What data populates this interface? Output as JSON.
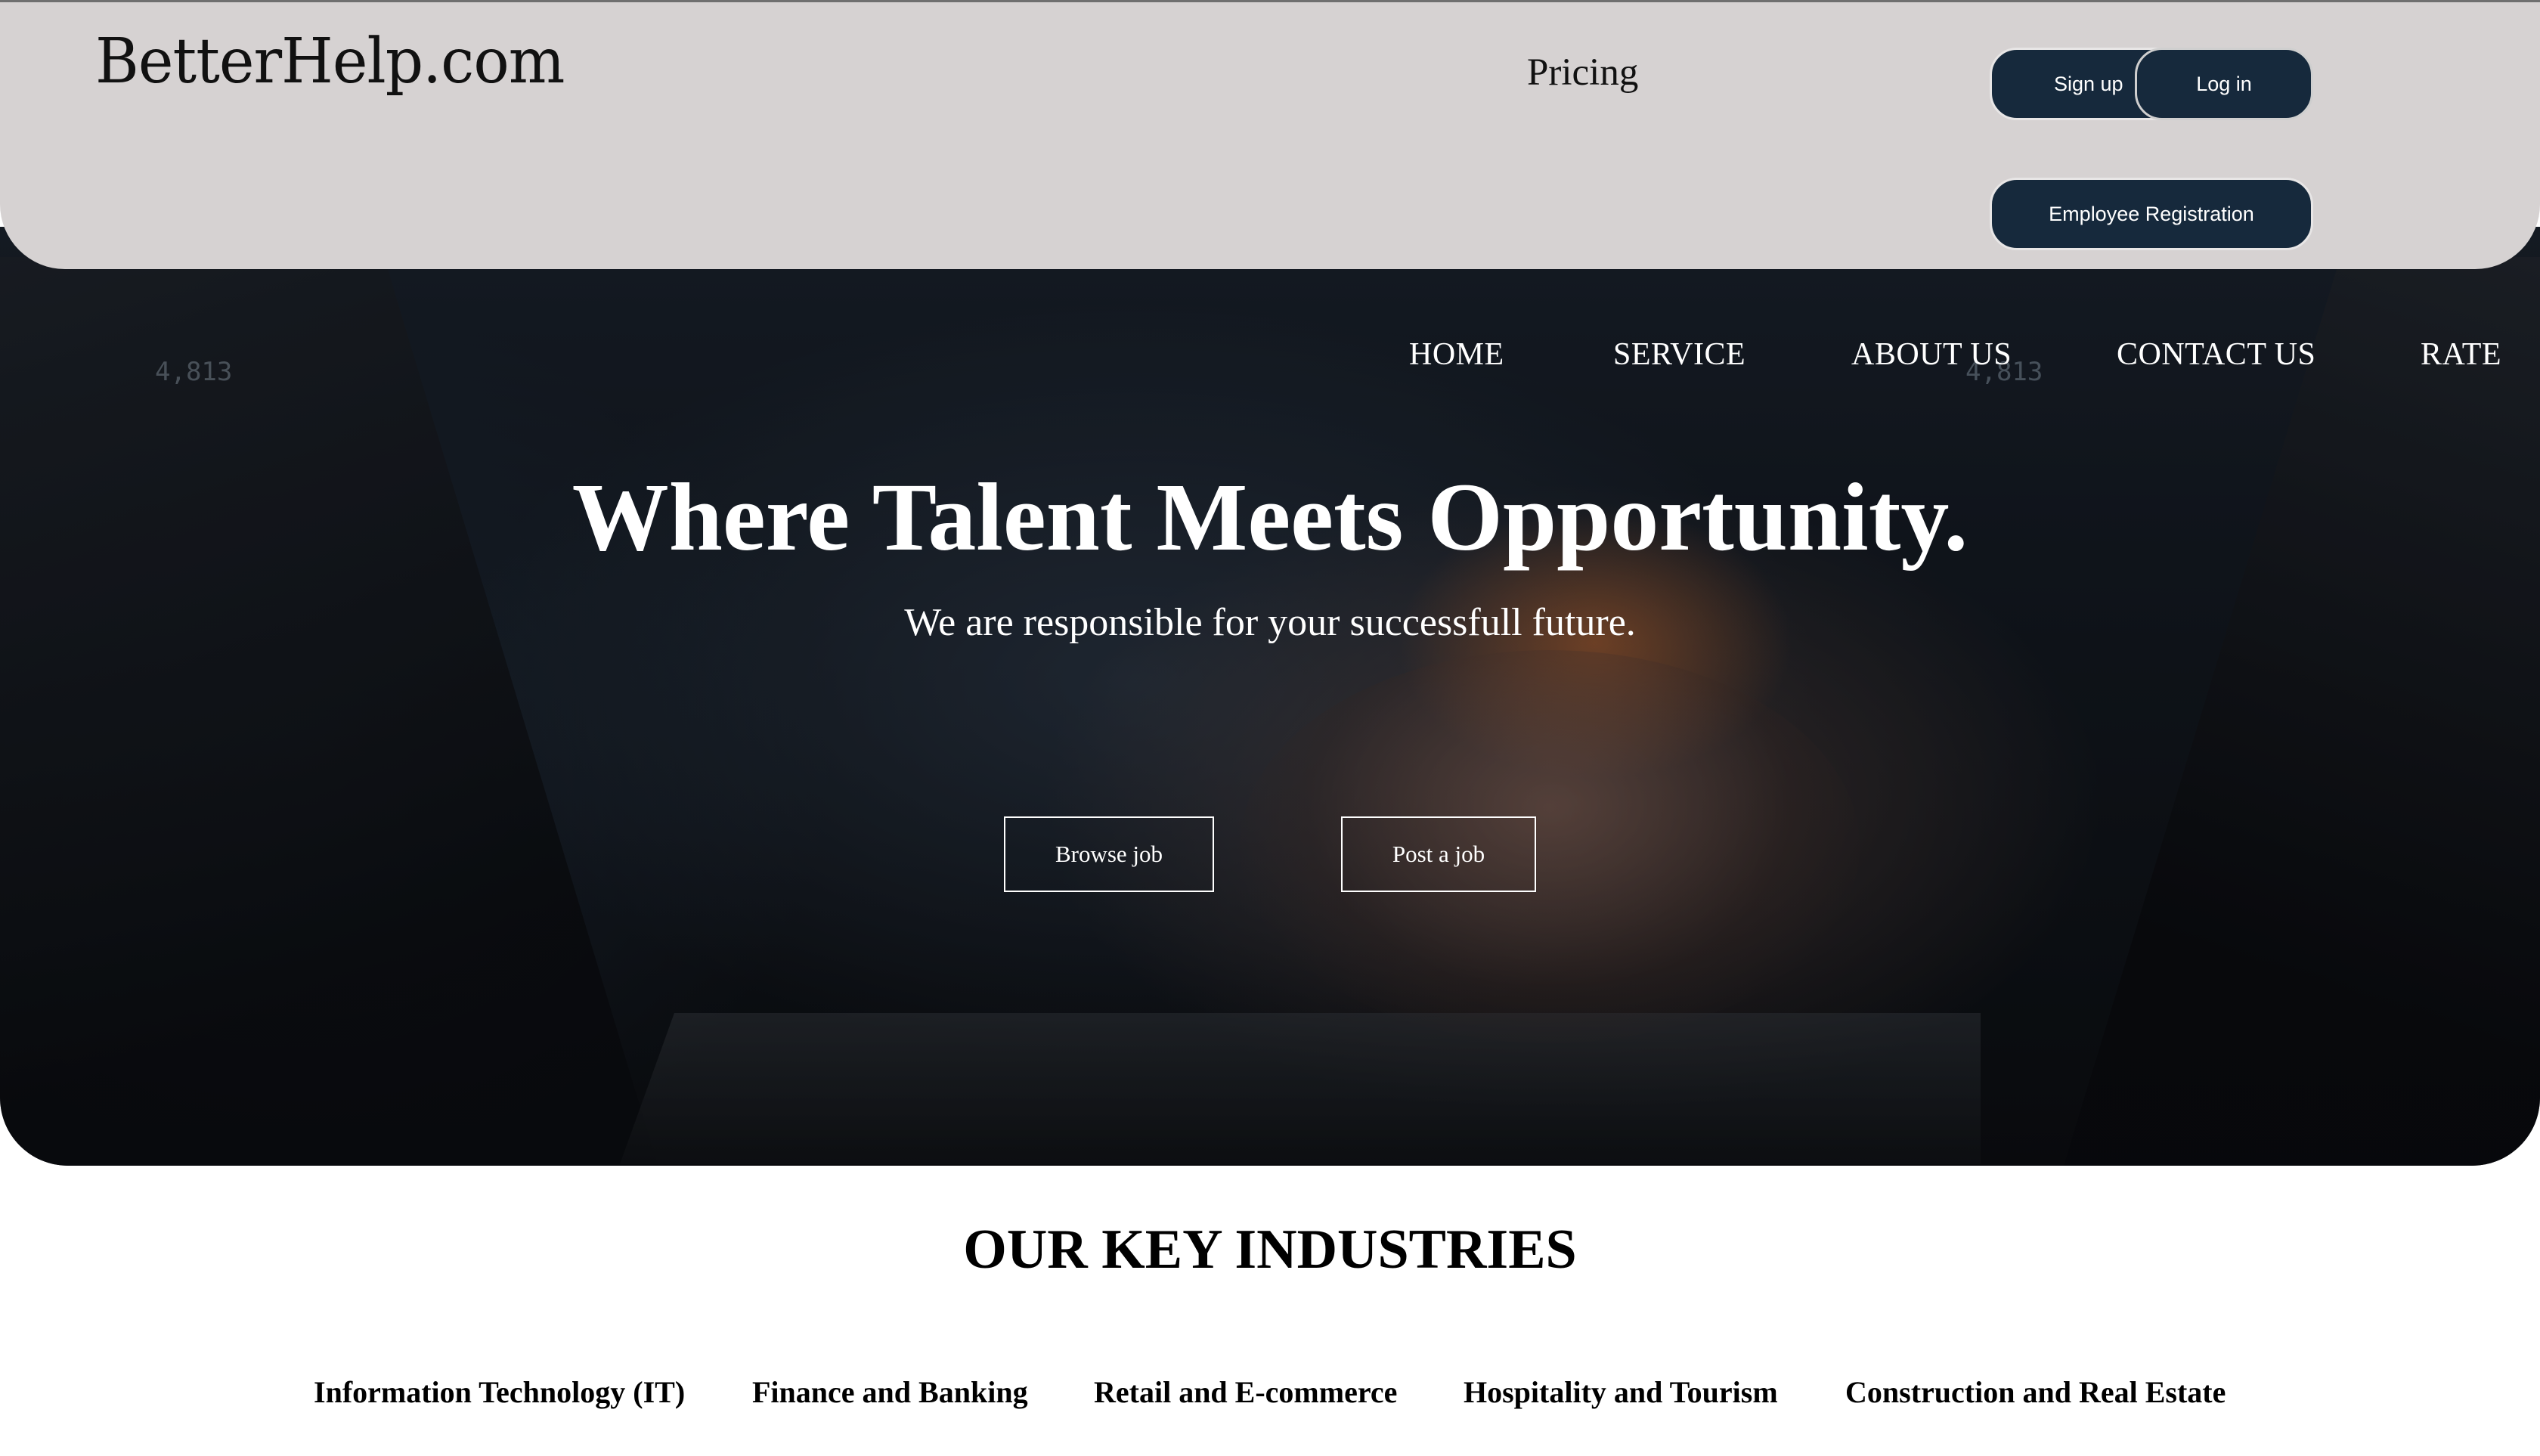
{
  "header": {
    "logo_text": "BetterHelp.com",
    "pricing_label": "Pricing",
    "signup_label": "Sign up",
    "login_label": "Log in",
    "employee_registration_label": "Employee Registration"
  },
  "nav": {
    "items": [
      {
        "label": "HOME"
      },
      {
        "label": "SERVICE"
      },
      {
        "label": "ABOUT US"
      },
      {
        "label": "CONTACT US"
      },
      {
        "label": "RATE"
      }
    ]
  },
  "hero": {
    "headline": "Where Talent Meets Opportunity.",
    "subheadline": "We are responsible for your successfull future.",
    "browse_label": "Browse job",
    "post_label": "Post a job",
    "readouts": [
      "4,813",
      "4,813"
    ]
  },
  "industries": {
    "title": "OUR KEY INDUSTRIES",
    "items": [
      {
        "label": "Information Technology (IT)"
      },
      {
        "label": "Finance and Banking"
      },
      {
        "label": "Retail and E-commerce"
      },
      {
        "label": "Hospitality and Tourism"
      },
      {
        "label": "Construction and Real Estate"
      }
    ]
  },
  "colors": {
    "header_bg": "#d6d2d2",
    "button_navy": "#16293c",
    "hero_text": "#ffffff"
  }
}
